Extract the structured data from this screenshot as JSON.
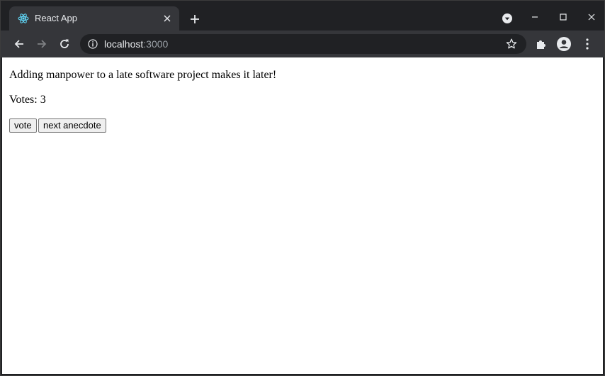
{
  "tab": {
    "title": "React App",
    "favicon": "react-logo-icon",
    "close_icon": "close-icon"
  },
  "toolbar": {
    "url_host": "localhost",
    "url_port": ":3000"
  },
  "content": {
    "anecdote": "Adding manpower to a late software project makes it later!",
    "votes_label": "Votes: 3",
    "vote_button": "vote",
    "next_button": "next anecdote"
  },
  "colors": {
    "frame": "#202124",
    "toolbar": "#35363a",
    "accent": "#61dafb"
  }
}
